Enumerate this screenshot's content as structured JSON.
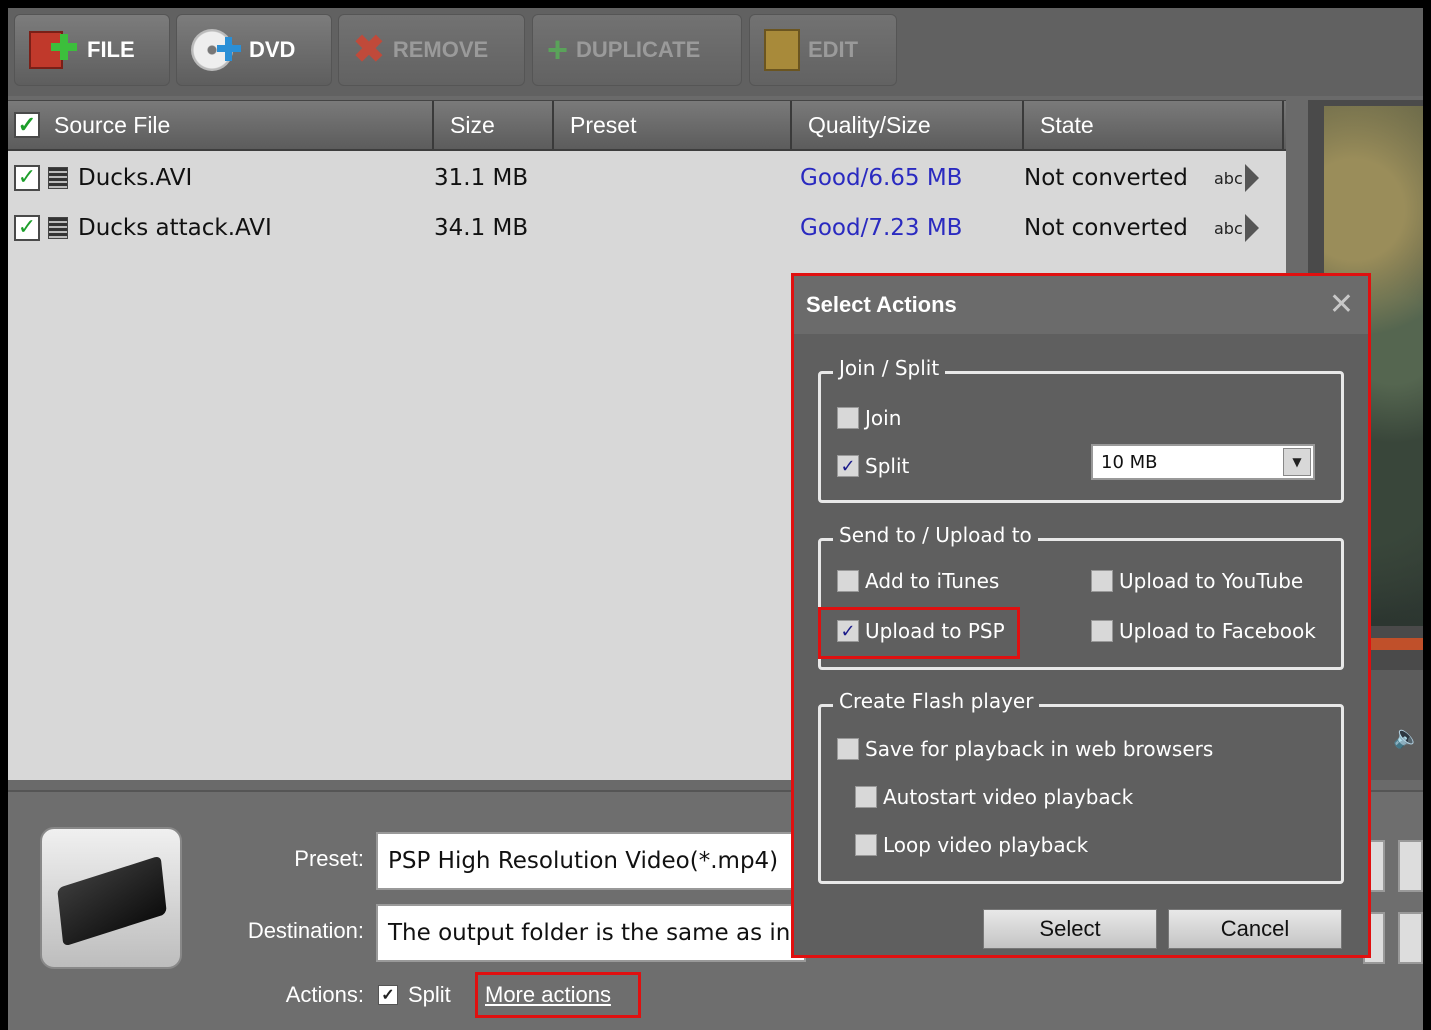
{
  "toolbar": {
    "file_label": "FILE",
    "dvd_label": "DVD",
    "remove_label": "REMOVE",
    "duplicate_label": "DUPLICATE",
    "edit_label": "EDIT"
  },
  "list": {
    "headers": {
      "source": "Source File",
      "size": "Size",
      "preset": "Preset",
      "quality": "Quality/Size",
      "state": "State"
    },
    "rows": [
      {
        "name": "Ducks.AVI",
        "size": "31.1 MB",
        "preset": "",
        "quality": "Good/6.65 MB",
        "state": "Not converted",
        "action": "abc"
      },
      {
        "name": "Ducks attack.AVI",
        "size": "34.1 MB",
        "preset": "",
        "quality": "Good/7.23 MB",
        "state": "Not converted",
        "action": "abc"
      }
    ]
  },
  "bottom": {
    "preset_label": "Preset:",
    "preset_value": "PSP High Resolution Video(*.mp4)",
    "destination_label": "Destination:",
    "destination_value": "The output folder is the same as in",
    "actions_label": "Actions:",
    "split_label": "Split",
    "more_actions": "More actions"
  },
  "dialog": {
    "title": "Select Actions",
    "close": "✕",
    "join_split": {
      "title": "Join / Split",
      "join": "Join",
      "split": "Split",
      "split_size": "10 MB"
    },
    "send_to": {
      "title": "Send to / Upload to",
      "itunes": "Add to iTunes",
      "youtube": "Upload to YouTube",
      "psp": "Upload to PSP",
      "facebook": "Upload to Facebook"
    },
    "flash": {
      "title": "Create Flash player",
      "save": "Save for playback in web browsers",
      "autostart": "Autostart video playback",
      "loop": "Loop video playback"
    },
    "select_label": "Select",
    "cancel_label": "Cancel"
  },
  "colors": {
    "highlight": "#e01010",
    "link": "#2a2ac0",
    "check": "#1c9e2a"
  }
}
